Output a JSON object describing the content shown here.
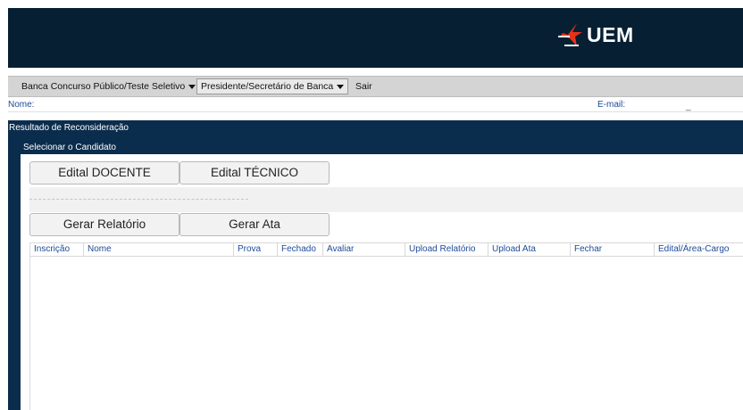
{
  "header": {
    "logo_text": "UEM"
  },
  "menubar": {
    "items": [
      {
        "label": "Banca Concurso Público/Teste Seletivo"
      },
      {
        "label": "Presidente/Secretário de Banca"
      },
      {
        "label": "Sair"
      }
    ]
  },
  "info": {
    "name_label": "Nome:",
    "email_label": "E-mail:",
    "email_value": "_"
  },
  "panels": {
    "outer_title": "Resultado de Reconsideração",
    "inner_title": "Selecionar o Candidato"
  },
  "buttons": {
    "edital_docente": "Edital DOCENTE",
    "edital_tecnico": "Edital TÉCNICO",
    "gerar_relatorio": "Gerar Relatório",
    "gerar_ata": "Gerar Ata"
  },
  "grid": {
    "columns": [
      "Inscrição",
      "Nome",
      "Prova",
      "Fechado",
      "Avaliar",
      "Upload Relatório",
      "Upload Ata",
      "Fechar",
      "Edital/Área-Cargo"
    ],
    "rows": []
  },
  "colors": {
    "header_bg": "#061f33",
    "panel_bg": "#0b2d4d",
    "menubar_bg": "#d4d4d4",
    "link_blue": "#1d4a9a"
  }
}
